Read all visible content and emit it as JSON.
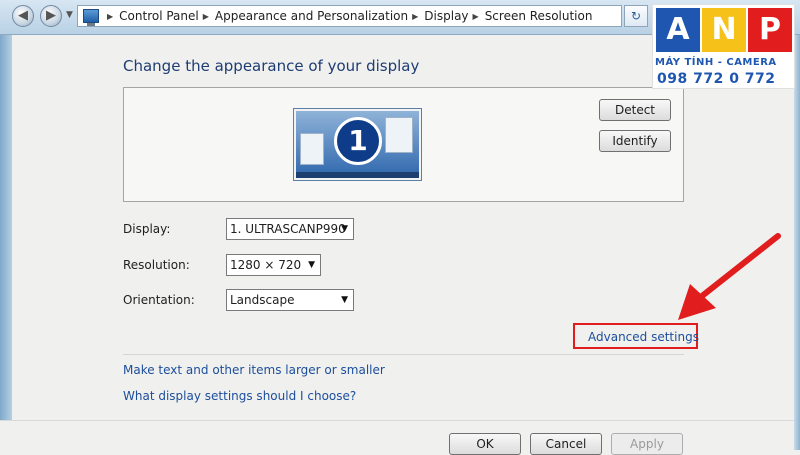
{
  "address_bar": {
    "crumbs": [
      "Control Panel",
      "Appearance and Personalization",
      "Display",
      "Screen Resolution"
    ]
  },
  "main": {
    "heading": "Change the appearance of your display",
    "monitor_number": "1",
    "detect_label": "Detect",
    "identify_label": "Identify",
    "display_label": "Display:",
    "display_value": "1. ULTRASCANP990",
    "resolution_label": "Resolution:",
    "resolution_value": "1280 × 720",
    "orientation_label": "Orientation:",
    "orientation_value": "Landscape",
    "advanced_link": "Advanced settings",
    "link_text_size": "Make text and other items larger or smaller",
    "link_help": "What display settings should I choose?"
  },
  "footer": {
    "ok": "OK",
    "cancel": "Cancel",
    "apply": "Apply"
  },
  "logo": {
    "letters": [
      "A",
      "N",
      "P"
    ],
    "tagline": "MÁY TÍNH - CAMERA",
    "phone": "098 772 0 772"
  },
  "colors": {
    "link": "#1c4e9c",
    "heading": "#1e3d73",
    "highlight": "#e11d1d",
    "logo_blue": "#1f57b0",
    "logo_yellow": "#f6c21a",
    "logo_red": "#e11d1d"
  },
  "icons": [
    "back-arrow-icon",
    "forward-arrow-icon",
    "control-panel-icon",
    "breadcrumb-chevron-icon",
    "refresh-icon",
    "dropdown-arrow-icon",
    "red-pointer-arrow-icon"
  ]
}
